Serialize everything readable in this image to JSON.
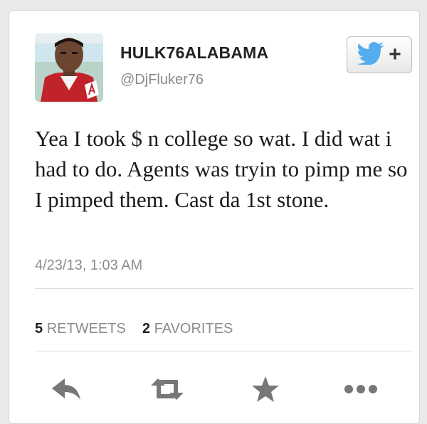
{
  "user": {
    "display_name": "HULK76ALABAMA",
    "handle": "@DjFluker76"
  },
  "follow_button": {
    "icon": "twitter-bird-icon",
    "label": "+"
  },
  "tweet": {
    "text": "Yea I took $ n college so wat. I did wat i had to do. Agents was tryin to pimp me so I pimped them. Cast da 1st stone.",
    "timestamp": "4/23/13, 1:03 AM"
  },
  "stats": {
    "retweets_count": "5",
    "retweets_label": "RETWEETS",
    "favorites_count": "2",
    "favorites_label": "FAVORITES"
  },
  "actions": [
    "reply-icon",
    "retweet-icon",
    "favorite-star-icon",
    "more-dots-icon"
  ],
  "colors": {
    "twitter_blue": "#55acee",
    "text": "#1b1b1b",
    "muted": "#8c8c8c",
    "icon": "#777777"
  }
}
